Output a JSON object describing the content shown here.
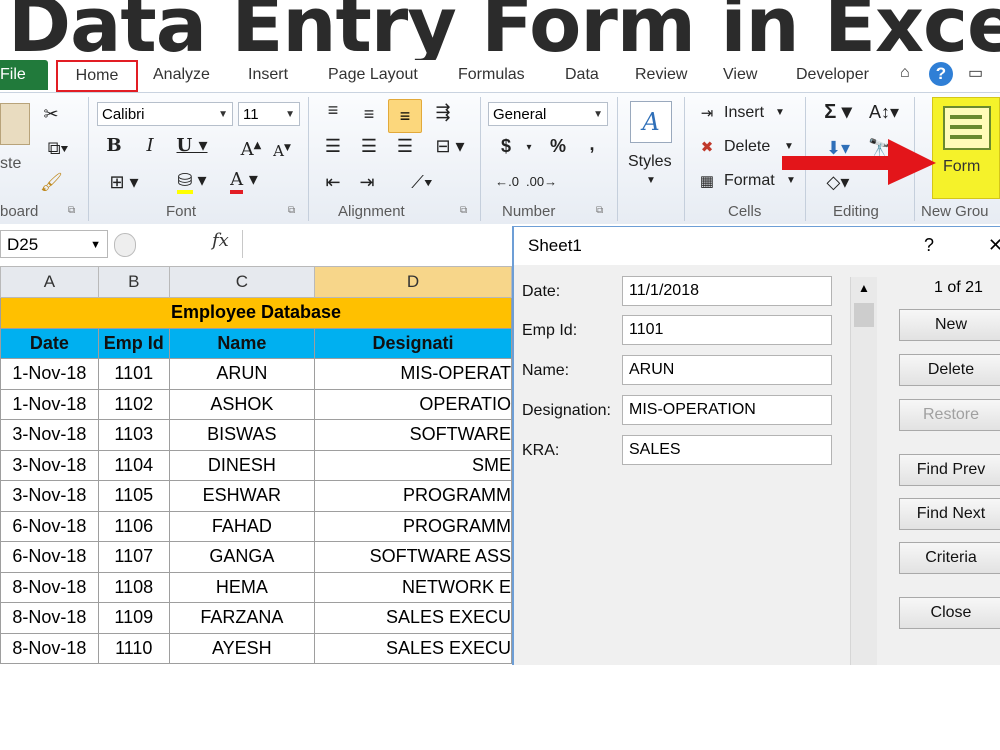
{
  "banner": {
    "title": "Data Entry Form in Excel"
  },
  "tabs": {
    "file": "File",
    "home": "Home",
    "analyze": "Analyze",
    "insert": "Insert",
    "page_layout": "Page Layout",
    "formulas": "Formulas",
    "data": "Data",
    "review": "Review",
    "view": "View",
    "developer": "Developer"
  },
  "ribbon": {
    "clipboard": {
      "label": "board",
      "paste": "ste"
    },
    "font": {
      "label": "Font",
      "name": "Calibri",
      "size": "11"
    },
    "alignment": {
      "label": "Alignment"
    },
    "number": {
      "label": "Number",
      "format": "General",
      "currency": "$",
      "percent": "%",
      "comma": ","
    },
    "styles": {
      "label": "Styles"
    },
    "cells": {
      "label": "Cells",
      "insert": "Insert",
      "delete": "Delete",
      "format": "Format"
    },
    "editing": {
      "label": "Editing"
    },
    "new_group": {
      "label": "New Grou",
      "form": "Form"
    }
  },
  "formula_bar": {
    "name_box": "D25",
    "fx": "fx",
    "value": ""
  },
  "sheet": {
    "col_headers": [
      "A",
      "B",
      "C",
      "D"
    ],
    "title": "Employee Database",
    "headers": [
      "Date",
      "Emp Id",
      "Name",
      "Designati"
    ],
    "rows": [
      [
        "1-Nov-18",
        "1101",
        "ARUN",
        "MIS-OPERAT"
      ],
      [
        "1-Nov-18",
        "1102",
        "ASHOK",
        "OPERATIO"
      ],
      [
        "3-Nov-18",
        "1103",
        "BISWAS",
        "SOFTWARE"
      ],
      [
        "3-Nov-18",
        "1104",
        "DINESH",
        "SME"
      ],
      [
        "3-Nov-18",
        "1105",
        "ESHWAR",
        "PROGRAMM"
      ],
      [
        "6-Nov-18",
        "1106",
        "FAHAD",
        "PROGRAMM"
      ],
      [
        "6-Nov-18",
        "1107",
        "GANGA",
        "SOFTWARE ASS"
      ],
      [
        "8-Nov-18",
        "1108",
        "HEMA",
        "NETWORK E"
      ],
      [
        "8-Nov-18",
        "1109",
        "FARZANA",
        "SALES EXECU"
      ],
      [
        "8-Nov-18",
        "1110",
        "AYESH",
        "SALES EXECU"
      ]
    ]
  },
  "dialog": {
    "title": "Sheet1",
    "help": "?",
    "close_x": "✕",
    "record_counter": "1 of 21",
    "fields": [
      {
        "label": "Date:",
        "value": "11/1/2018"
      },
      {
        "label": "Emp Id:",
        "value": "1101"
      },
      {
        "label": "Name:",
        "value": "ARUN"
      },
      {
        "label": "Designation:",
        "value": "MIS-OPERATION"
      },
      {
        "label": "KRA:",
        "value": "SALES"
      }
    ],
    "buttons": {
      "new": "New",
      "delete": "Delete",
      "restore": "Restore",
      "find_prev": "Find Prev",
      "find_next": "Find Next",
      "criteria": "Criteria",
      "close": "Close"
    }
  },
  "colors": {
    "file_tab": "#217a3b",
    "title_fill": "#ffc000",
    "header_fill": "#00b0f0",
    "arrow": "#e3151a",
    "form_button": "#f5f22a",
    "home_outline": "#e21d24"
  }
}
